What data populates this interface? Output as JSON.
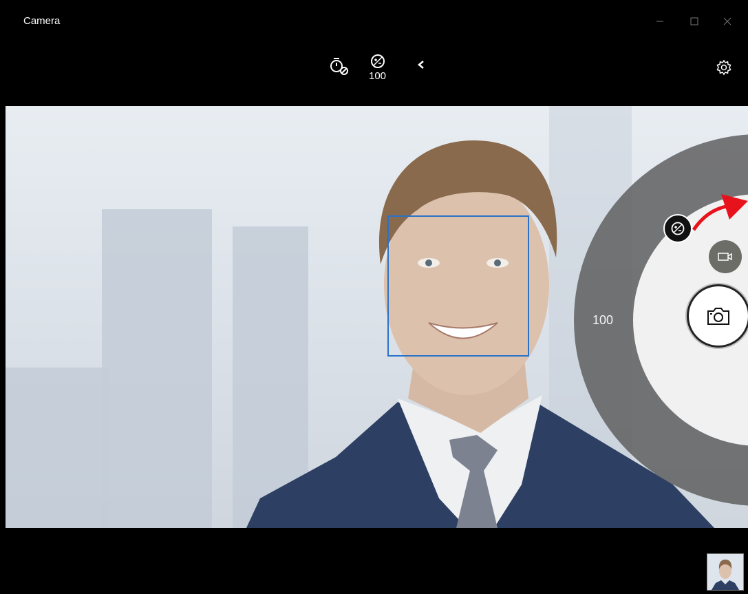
{
  "app": {
    "title": "Camera"
  },
  "window_controls": {
    "minimize": "minimize-icon",
    "maximize": "maximize-icon",
    "close": "close-icon"
  },
  "toolbar": {
    "timer_icon": "timer-off-icon",
    "exposure_icon": "exposure-icon",
    "exposure_value": "100",
    "collapse_icon": "chevron-left-icon",
    "settings_icon": "gear-icon"
  },
  "dial": {
    "value_label": "100",
    "knob_icon": "exposure-icon",
    "indicator_color": "#e8121d"
  },
  "capture": {
    "video_mode_icon": "video-camera-icon",
    "photo_shutter_icon": "camera-icon"
  },
  "viewfinder": {
    "face_detection_color": "#2a72c8"
  },
  "gallery": {
    "thumbnail": "last-photo-thumbnail"
  }
}
